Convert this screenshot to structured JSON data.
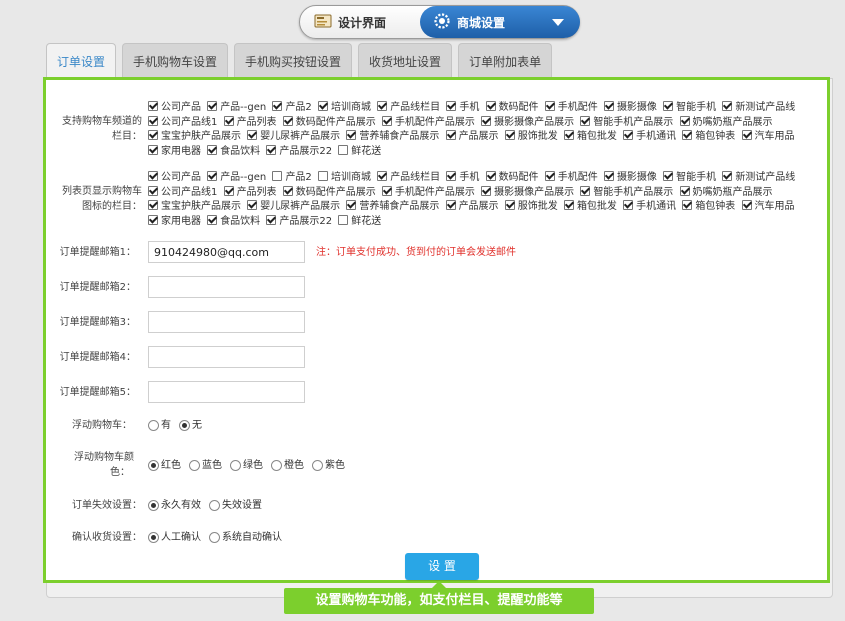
{
  "header": {
    "design_label": "设计界面",
    "mall_label": "商城设置"
  },
  "tabs": [
    {
      "label": "订单设置",
      "active": true
    },
    {
      "label": "手机购物车设置",
      "active": false
    },
    {
      "label": "手机购买按钮设置",
      "active": false
    },
    {
      "label": "收货地址设置",
      "active": false
    },
    {
      "label": "订单附加表单",
      "active": false
    }
  ],
  "form": {
    "cart_channels": {
      "label_line1": "支持购物车频道的",
      "label_line2": "栏目：",
      "items": [
        {
          "label": "公司产品",
          "checked": true
        },
        {
          "label": "产品--gen",
          "checked": true
        },
        {
          "label": "产品2",
          "checked": true
        },
        {
          "label": "培训商城",
          "checked": true
        },
        {
          "label": "产品线栏目",
          "checked": true
        },
        {
          "label": "手机",
          "checked": true
        },
        {
          "label": "数码配件",
          "checked": true
        },
        {
          "label": "手机配件",
          "checked": true
        },
        {
          "label": "摄影摄像",
          "checked": true
        },
        {
          "label": "智能手机",
          "checked": true
        },
        {
          "label": "新测试产品线",
          "checked": true
        },
        {
          "label": "公司产品线1",
          "checked": true
        },
        {
          "label": "产品列表",
          "checked": true
        },
        {
          "label": "数码配件产品展示",
          "checked": true
        },
        {
          "label": "手机配件产品展示",
          "checked": true
        },
        {
          "label": "摄影摄像产品展示",
          "checked": true
        },
        {
          "label": "智能手机产品展示",
          "checked": true
        },
        {
          "label": "奶嘴奶瓶产品展示",
          "checked": true
        },
        {
          "label": "宝宝护肤产品展示",
          "checked": true
        },
        {
          "label": "婴儿尿裤产品展示",
          "checked": true
        },
        {
          "label": "营养辅食产品展示",
          "checked": true
        },
        {
          "label": "产品展示",
          "checked": true
        },
        {
          "label": "服饰批发",
          "checked": true
        },
        {
          "label": "箱包批发",
          "checked": true
        },
        {
          "label": "手机通讯",
          "checked": true
        },
        {
          "label": "箱包钟表",
          "checked": true
        },
        {
          "label": "汽车用品",
          "checked": true
        },
        {
          "label": "家用电器",
          "checked": true
        },
        {
          "label": "食品饮料",
          "checked": true
        },
        {
          "label": "产品展示22",
          "checked": true
        },
        {
          "label": "鲜花送",
          "checked": false
        }
      ]
    },
    "list_cart_icon": {
      "label_line1": "列表页显示购物车",
      "label_line2": "图标的栏目：",
      "items": [
        {
          "label": "公司产品",
          "checked": true
        },
        {
          "label": "产品--gen",
          "checked": true
        },
        {
          "label": "产品2",
          "checked": false
        },
        {
          "label": "培训商城",
          "checked": false
        },
        {
          "label": "产品线栏目",
          "checked": true
        },
        {
          "label": "手机",
          "checked": true
        },
        {
          "label": "数码配件",
          "checked": true
        },
        {
          "label": "手机配件",
          "checked": true
        },
        {
          "label": "摄影摄像",
          "checked": true
        },
        {
          "label": "智能手机",
          "checked": true
        },
        {
          "label": "新测试产品线",
          "checked": true
        },
        {
          "label": "公司产品线1",
          "checked": true
        },
        {
          "label": "产品列表",
          "checked": true
        },
        {
          "label": "数码配件产品展示",
          "checked": true
        },
        {
          "label": "手机配件产品展示",
          "checked": true
        },
        {
          "label": "摄影摄像产品展示",
          "checked": true
        },
        {
          "label": "智能手机产品展示",
          "checked": true
        },
        {
          "label": "奶嘴奶瓶产品展示",
          "checked": true
        },
        {
          "label": "宝宝护肤产品展示",
          "checked": true
        },
        {
          "label": "婴儿尿裤产品展示",
          "checked": true
        },
        {
          "label": "营养辅食产品展示",
          "checked": true
        },
        {
          "label": "产品展示",
          "checked": true
        },
        {
          "label": "服饰批发",
          "checked": true
        },
        {
          "label": "箱包批发",
          "checked": true
        },
        {
          "label": "手机通讯",
          "checked": true
        },
        {
          "label": "箱包钟表",
          "checked": true
        },
        {
          "label": "汽车用品",
          "checked": true
        },
        {
          "label": "家用电器",
          "checked": true
        },
        {
          "label": "食品饮料",
          "checked": true
        },
        {
          "label": "产品展示22",
          "checked": true
        },
        {
          "label": "鲜花送",
          "checked": false
        }
      ]
    },
    "emails": [
      {
        "label": "订单提醒邮箱1：",
        "value": "910424980@qq.com"
      },
      {
        "label": "订单提醒邮箱2：",
        "value": ""
      },
      {
        "label": "订单提醒邮箱3：",
        "value": ""
      },
      {
        "label": "订单提醒邮箱4：",
        "value": ""
      },
      {
        "label": "订单提醒邮箱5：",
        "value": ""
      }
    ],
    "email_note": "注：订单支付成功、货到付的订单会发送邮件",
    "float_cart": {
      "label": "浮动购物车：",
      "options": [
        {
          "label": "有",
          "selected": false
        },
        {
          "label": "无",
          "selected": true
        }
      ]
    },
    "float_cart_color": {
      "label_line1": "浮动购物车颜",
      "label_line2": "色：",
      "options": [
        {
          "label": "红色",
          "selected": true
        },
        {
          "label": "蓝色",
          "selected": false
        },
        {
          "label": "绿色",
          "selected": false
        },
        {
          "label": "橙色",
          "selected": false
        },
        {
          "label": "紫色",
          "selected": false
        }
      ]
    },
    "order_expire": {
      "label": "订单失效设置：",
      "options": [
        {
          "label": "永久有效",
          "selected": true
        },
        {
          "label": "失效设置",
          "selected": false
        }
      ]
    },
    "confirm_receipt": {
      "label": "确认收货设置：",
      "options": [
        {
          "label": "人工确认",
          "selected": true
        },
        {
          "label": "系统自动确认",
          "selected": false
        }
      ]
    },
    "submit_label": "设 置"
  },
  "callout": "设置购物车功能，如支付栏目、提醒功能等",
  "colors": {
    "accent_green": "#7ccf2d",
    "button_blue": "#29a6e6",
    "note_red": "#e0302b",
    "header_blue": "#1e5fa8"
  }
}
